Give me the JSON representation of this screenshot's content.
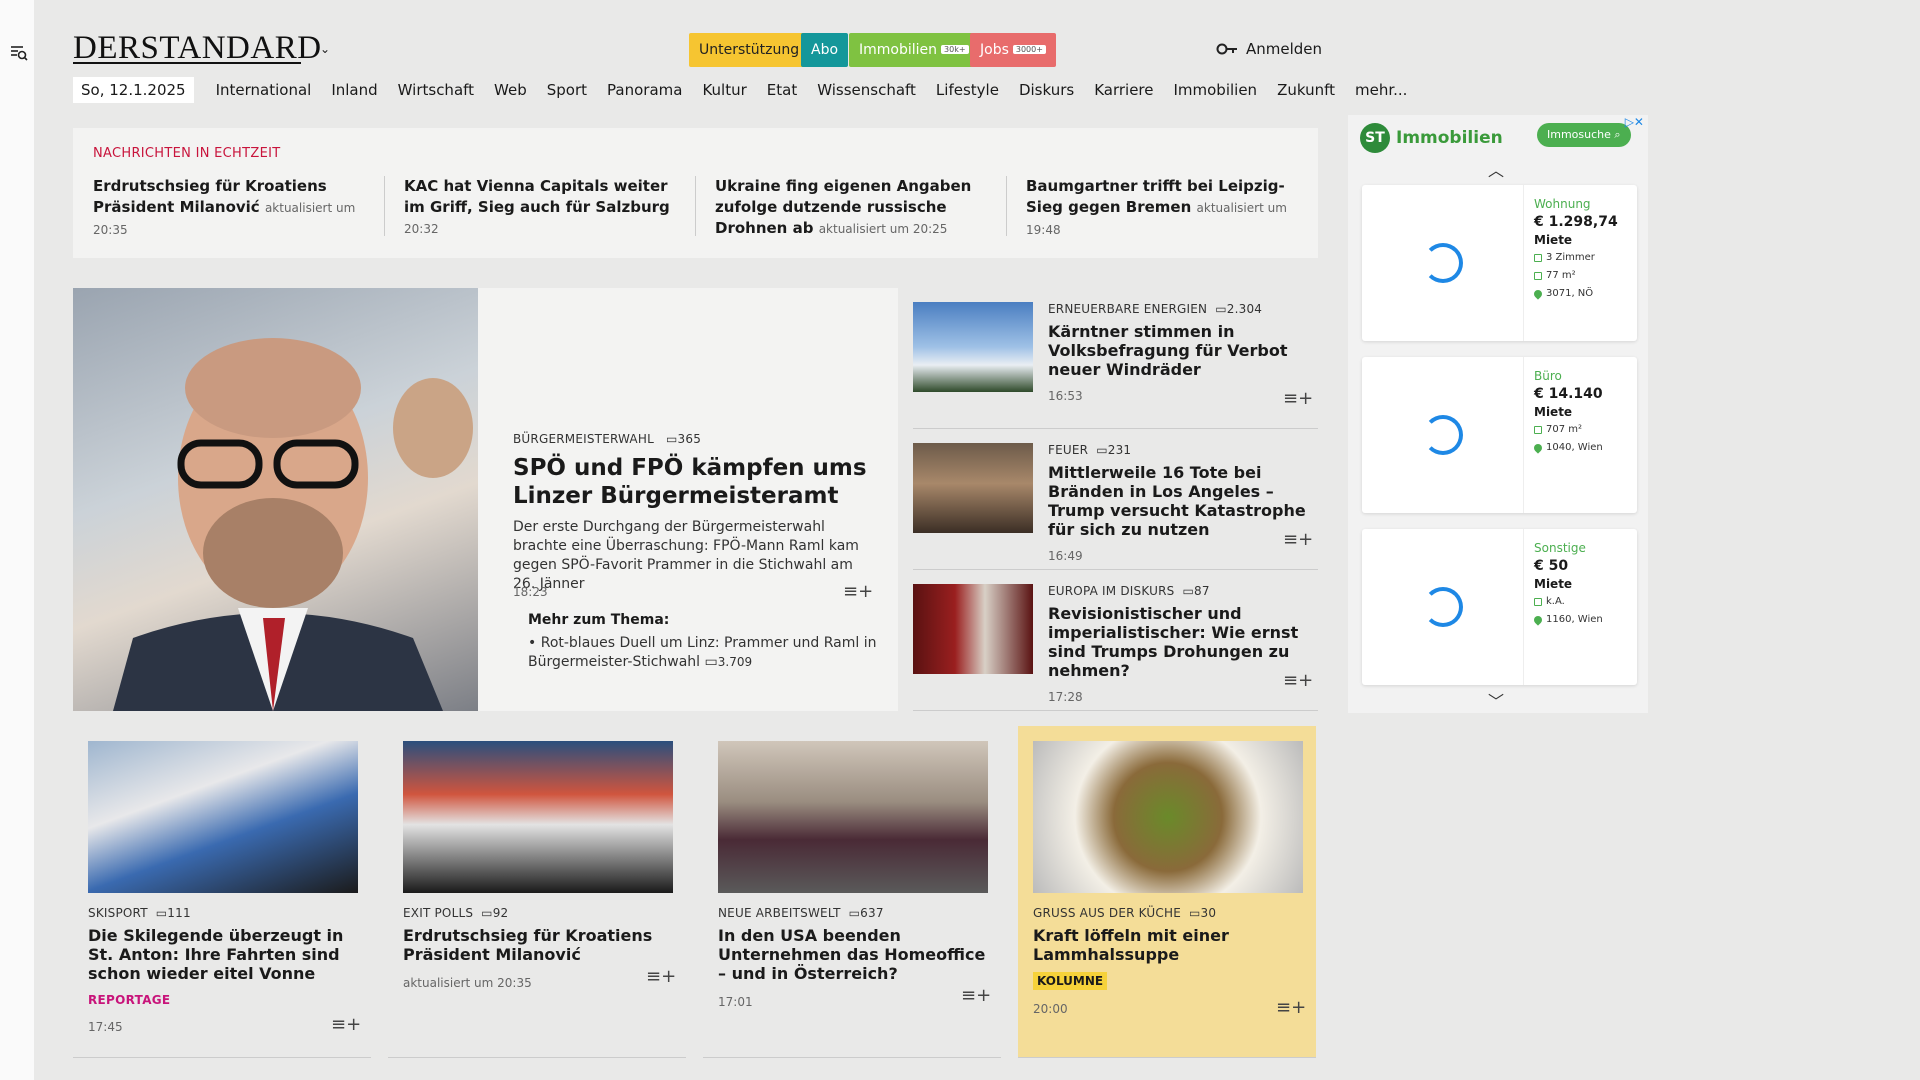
{
  "header": {
    "logo": "DERSTANDARD",
    "pills": [
      {
        "label": "Unterstützung",
        "bg": "#f6c531",
        "fg": "#222"
      },
      {
        "label": "Abo",
        "bg": "#14979a",
        "fg": "#fff"
      },
      {
        "label": "Immobilien",
        "badge": "30k+",
        "bg": "#7fc241",
        "fg": "#fff"
      },
      {
        "label": "Jobs",
        "badge": "3000+",
        "bg": "#e86c6c",
        "fg": "#fff"
      }
    ],
    "login": "Anmelden"
  },
  "nav": {
    "date": "So, 12.1.2025",
    "items": [
      "International",
      "Inland",
      "Wirtschaft",
      "Web",
      "Sport",
      "Panorama",
      "Kultur",
      "Etat",
      "Wissenschaft",
      "Lifestyle",
      "Diskurs",
      "Karriere",
      "Immobilien",
      "Zukunft",
      "mehr..."
    ]
  },
  "ticker": {
    "heading": "NACHRICHTEN IN ECHTZEIT",
    "items": [
      {
        "title": "Erdrutschsieg für Kroatiens Präsident Milanović",
        "meta": "aktualisiert um 20:35"
      },
      {
        "title": "KAC hat Vienna Capitals weiter im Griff, Sieg auch für Salzburg",
        "meta": "20:32"
      },
      {
        "title": "Ukraine fing eigenen Angaben zufolge dutzende russische Drohnen ab",
        "meta": "aktualisiert um 20:25"
      },
      {
        "title": "Baumgartner trifft bei Leipzig-Sieg gegen Bremen",
        "meta": "aktualisiert um 19:48"
      }
    ]
  },
  "hero": {
    "kicker": "BÜRGERMEISTERWAHL",
    "comments": "365",
    "title": "SPÖ und FPÖ kämpfen ums Linzer Bürgermeisteramt",
    "lead": "Der erste Durchgang der Bürgermeisterwahl brachte eine Überraschung: FPÖ-Mann Raml kam gegen SPÖ-Favorit Prammer in die Stichwahl am 26. Jänner",
    "time": "18:23",
    "more_heading": "Mehr zum Thema:",
    "more_item": "Rot-blaues Duell um Linz: Prammer und Raml in Bürgermeister-Stichwahl",
    "more_comments": "3.709"
  },
  "side": [
    {
      "kicker": "ERNEUERBARE ENERGIEN",
      "comments": "2.304",
      "title": "Kärntner stimmen in Volksbefragung für Verbot neuer Windräder",
      "time": "16:53"
    },
    {
      "kicker": "FEUER",
      "comments": "231",
      "title": "Mittlerweile 16 Tote bei Bränden in Los Angeles – Trump versucht Katastrophe für sich zu nutzen",
      "time": "16:49"
    },
    {
      "kicker": "EUROPA IM DISKURS",
      "comments": "87",
      "title": "Revisionistischer und imperialistischer: Wie ernst sind Trumps Drohungen zu nehmen?",
      "time": "17:28"
    }
  ],
  "cards": [
    {
      "kicker": "SKISPORT",
      "comments": "111",
      "title": "Die Skilegende überzeugt in St. Anton: Ihre Fahrten sind schon wieder eitel Vonne",
      "label": "REPORTAGE",
      "time": "17:45"
    },
    {
      "kicker": "EXIT POLLS",
      "comments": "92",
      "title": "Erdrutschsieg für Kroatiens Präsident Milanović",
      "time": "aktualisiert um 20:35"
    },
    {
      "kicker": "NEUE ARBEITSWELT",
      "comments": "637",
      "title": "In den USA beenden Unternehmen das Homeoffice – und in Österreich?",
      "time": "17:01"
    },
    {
      "kicker": "GRUSS AUS DER KÜCHE",
      "comments": "30",
      "title": "Kraft löffeln mit einer Lammhalssuppe",
      "label": "KOLUMNE",
      "time": "20:00"
    }
  ],
  "ad": {
    "brand": "Immobilien",
    "brand_badge": "ST",
    "search": "Immosuche",
    "listings": [
      {
        "type": "Wohnung",
        "price": "€ 1.298,74",
        "rent": "Miete",
        "rooms": "3 Zimmer",
        "area": "77 m²",
        "loc": "3071, NÖ"
      },
      {
        "type": "Büro",
        "price": "€ 14.140",
        "rent": "Miete",
        "area": "707 m²",
        "loc": "1040, Wien"
      },
      {
        "type": "Sonstige",
        "price": "€ 50",
        "rent": "Miete",
        "area": "k.A.",
        "loc": "1160, Wien"
      }
    ]
  }
}
